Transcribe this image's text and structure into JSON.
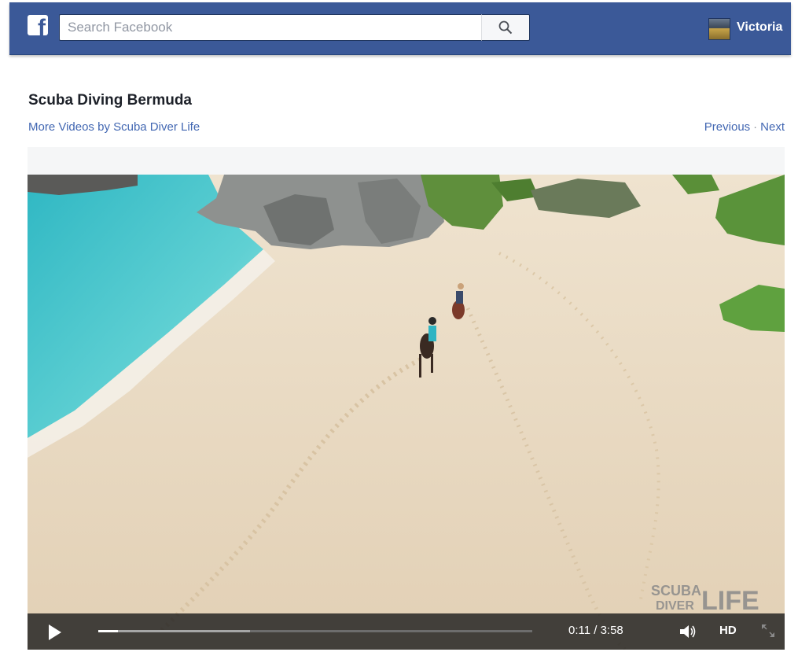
{
  "topbar": {
    "search_placeholder": "Search Facebook",
    "user_name": "Victoria",
    "brand_color": "#3b5998"
  },
  "video": {
    "title": "Scuba Diving Bermuda",
    "more_videos_link": "More Videos by Scuba Diver Life",
    "previous_label": "Previous",
    "separator": "·",
    "next_label": "Next",
    "controls": {
      "time": "0:11 / 3:58",
      "progress_fraction": 0.046,
      "buffered_fraction": 0.35,
      "hd_label": "HD"
    },
    "watermark": "SCUBA DIVER LIFE"
  }
}
